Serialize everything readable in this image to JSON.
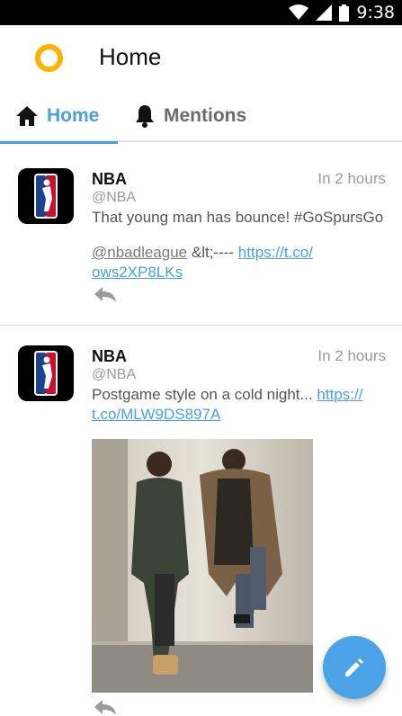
{
  "status_bar": {
    "time": "9:38"
  },
  "app_bar": {
    "title": "Home",
    "logo_color": "#ffb300"
  },
  "tabs": [
    {
      "label": "Home",
      "icon": "home-icon",
      "active": true
    },
    {
      "label": "Mentions",
      "icon": "bell-icon",
      "active": false
    }
  ],
  "accent_color": "#4a9fdc",
  "tweets": [
    {
      "name": "NBA",
      "handle": "@NBA",
      "time": "In 2 hours",
      "text_line1": "That young man has bounce! #GoSpursGo",
      "mention": "@nbadleague",
      "mid_text": " &lt;---- ",
      "link": "https://t.co/ows2XP8LKs",
      "link_part1": "https://t.co/",
      "link_part2": "ows2XP8LKs"
    },
    {
      "name": "NBA",
      "handle": "@NBA",
      "time": "In 2 hours",
      "text": "Postgame style on a cold night... ",
      "link_part1": "https://",
      "link_part2": "t.co/MLW9DS897A",
      "has_photo": true
    }
  ],
  "fab": {
    "icon": "pencil-icon"
  }
}
